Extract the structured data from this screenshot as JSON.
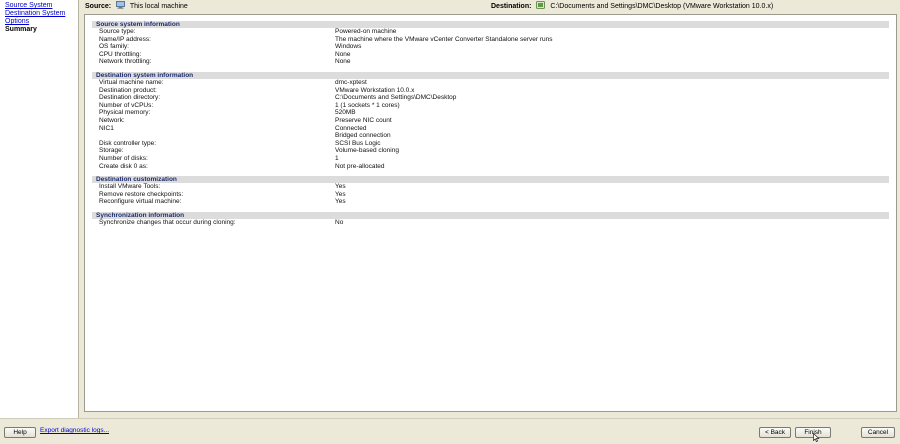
{
  "sidebar": {
    "items": [
      {
        "label": "Source System",
        "link": true
      },
      {
        "label": "Destination System",
        "link": true
      },
      {
        "label": "Options",
        "link": true
      },
      {
        "label": "Summary",
        "link": false
      }
    ]
  },
  "header": {
    "source_label": "Source:",
    "source_value": "This local machine",
    "destination_label": "Destination:",
    "destination_value": "C:\\Documents and Settings\\DMC\\Desktop (VMware Workstation 10.0.x)"
  },
  "sections": [
    {
      "title": "Source system information",
      "rows": [
        {
          "k": "Source type:",
          "v": "Powered-on machine"
        },
        {
          "k": "Name/IP address:",
          "v": "The machine where the VMware vCenter Converter Standalone server runs"
        },
        {
          "k": "OS family:",
          "v": "Windows"
        },
        {
          "k": "CPU throttling:",
          "v": "None"
        },
        {
          "k": "Network throttling:",
          "v": "None"
        }
      ]
    },
    {
      "title": "Destination system information",
      "rows": [
        {
          "k": "Virtual machine name:",
          "v": "dmc-xptest"
        },
        {
          "k": "Destination product:",
          "v": "VMware Workstation 10.0.x"
        },
        {
          "k": "Destination directory:",
          "v": "C:\\Documents and Settings\\DMC\\Desktop"
        },
        {
          "k": "Number of vCPUs:",
          "v": "1 (1 sockets * 1 cores)"
        },
        {
          "k": "Physical memory:",
          "v": "520MB"
        },
        {
          "k": "Network:",
          "v": "Preserve NIC count"
        },
        {
          "k": "NIC1",
          "v": "Connected"
        },
        {
          "k": "",
          "v": "Bridged connection"
        },
        {
          "k": "Disk controller type:",
          "v": "SCSI Bus Logic"
        },
        {
          "k": "Storage:",
          "v": "Volume-based cloning"
        },
        {
          "k": "Number of disks:",
          "v": "1"
        },
        {
          "k": "Create disk 0 as:",
          "v": "Not pre-allocated"
        }
      ]
    },
    {
      "title": "Destination customization",
      "rows": [
        {
          "k": "Install VMware Tools:",
          "v": "Yes"
        },
        {
          "k": "Remove restore checkpoints:",
          "v": "Yes"
        },
        {
          "k": "Reconfigure virtual machine:",
          "v": "Yes"
        }
      ]
    },
    {
      "title": "Synchronization information",
      "rows": [
        {
          "k": "Synchronize changes that occur during cloning:",
          "v": "No"
        }
      ]
    }
  ],
  "footer": {
    "help_label": "Help",
    "export_label": "Export diagnostic logs...",
    "back_label": "< Back",
    "finish_label": "Finish",
    "cancel_label": "Cancel"
  },
  "icons": {
    "source": "computer-icon",
    "destination": "vm-workstation-icon",
    "cursor": "mouse-pointer-icon"
  }
}
